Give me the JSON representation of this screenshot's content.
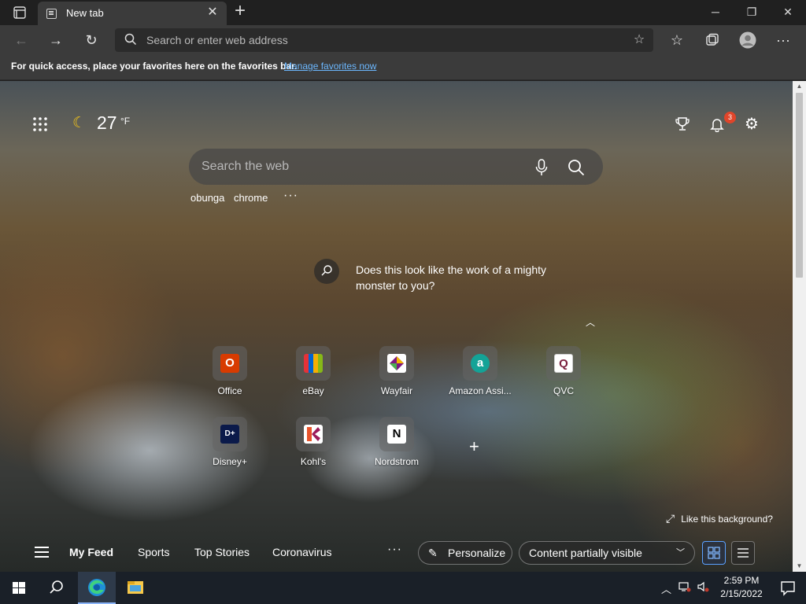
{
  "browser": {
    "tab": {
      "title": "New tab"
    },
    "window_controls": {
      "minimize": "─",
      "restore": "❐",
      "close": "✕"
    },
    "address_bar": {
      "placeholder": "Search or enter web address"
    },
    "favorites_bar": {
      "message": "For quick access, place your favorites here on the favorites bar.",
      "link": "Manage favorites now"
    }
  },
  "newtab": {
    "weather": {
      "temperature": "27",
      "unit": "°F",
      "icon": "moon-icon"
    },
    "notifications": {
      "count": "3"
    },
    "search": {
      "placeholder": "Search the web"
    },
    "history": [
      "obunga",
      "chrome"
    ],
    "history_more": "···",
    "fact": {
      "text": "Does this look like the work of a mighty monster to you?"
    },
    "quick_links": [
      {
        "label": "Office",
        "color": "#d83b01",
        "glyph": "O"
      },
      {
        "label": "eBay",
        "color": "#86b817",
        "glyph": "e"
      },
      {
        "label": "Wayfair",
        "color": "#7f187f",
        "glyph": "W"
      },
      {
        "label": "Amazon Assi...",
        "color": "#14a397",
        "glyph": "a"
      },
      {
        "label": "QVC",
        "color": "#ffffff",
        "glyph": "Q"
      },
      {
        "label": "Disney+",
        "color": "#0b1a4a",
        "glyph": "D+"
      },
      {
        "label": "Kohl's",
        "color": "#9b1b5a",
        "glyph": "K"
      },
      {
        "label": "Nordstrom",
        "color": "#ffffff",
        "glyph": "N"
      }
    ],
    "like_background": "Like this background?",
    "feed": {
      "tabs": [
        "My Feed",
        "Sports",
        "Top Stories",
        "Coronavirus"
      ],
      "more": "···",
      "personalize": "Personalize",
      "visibility": "Content partially visible"
    }
  },
  "taskbar": {
    "time": "2:59 PM",
    "date": "2/15/2022"
  }
}
